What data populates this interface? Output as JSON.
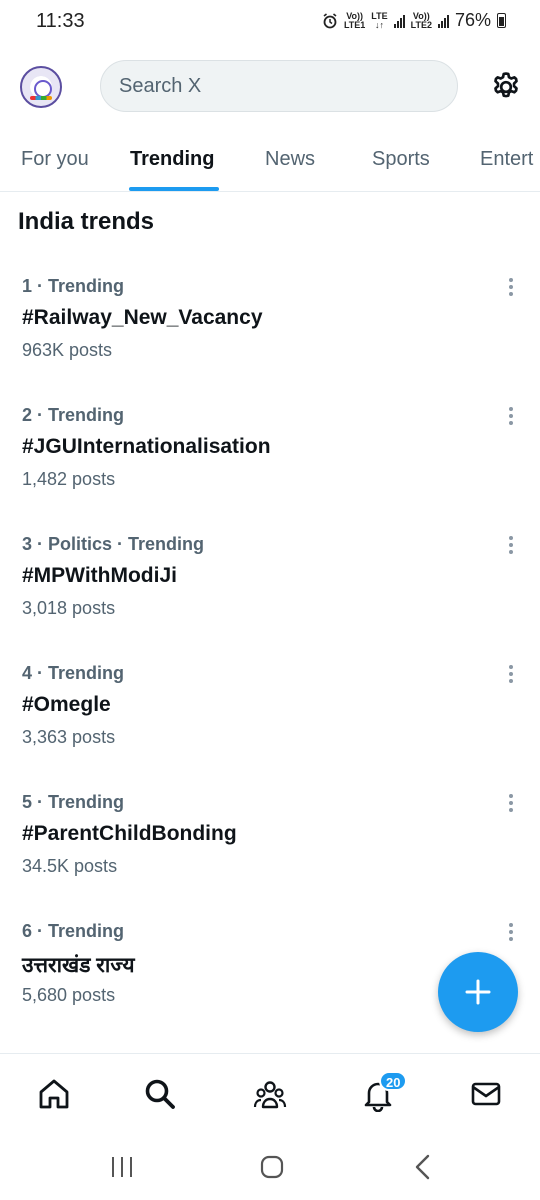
{
  "status_bar": {
    "time": "11:33",
    "net1_top": "Vo))",
    "net1_bottom": "LTE1",
    "lte_top": "LTE",
    "lte_bottom": "↓↑",
    "net2_top": "Vo))",
    "net2_bottom": "LTE2",
    "battery": "76%"
  },
  "header": {
    "search_placeholder": "Search X"
  },
  "tabs": [
    {
      "label": "For you"
    },
    {
      "label": "Trending"
    },
    {
      "label": "News"
    },
    {
      "label": "Sports"
    },
    {
      "label": "Entert"
    }
  ],
  "section": {
    "title": "India trends"
  },
  "trends": [
    {
      "meta": "1 · Trending",
      "name": "#Railway_New_Vacancy",
      "count": "963K posts"
    },
    {
      "meta": "2 · Trending",
      "name": "#JGUInternationalisation",
      "count": "1,482 posts"
    },
    {
      "meta": "3 · Politics · Trending",
      "name": "#MPWithModiJi",
      "count": "3,018 posts"
    },
    {
      "meta": "4 · Trending",
      "name": "#Omegle",
      "count": "3,363 posts"
    },
    {
      "meta": "5 · Trending",
      "name": "#ParentChildBonding",
      "count": "34.5K posts"
    },
    {
      "meta": "6 · Trending",
      "name": "उत्तराखंड राज्य",
      "count": "5,680 posts"
    }
  ],
  "bottom_nav": {
    "notification_count": "20"
  },
  "colors": {
    "accent": "#1d9bf0",
    "text": "#0f1419",
    "muted": "#536471"
  }
}
